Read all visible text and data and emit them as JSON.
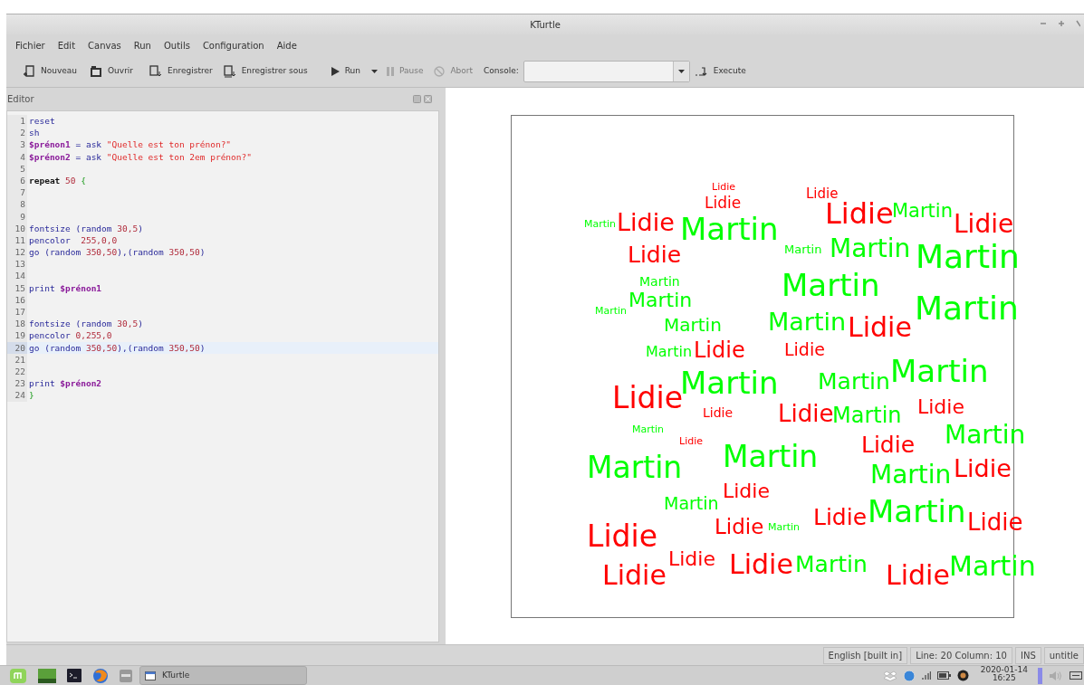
{
  "window": {
    "title": "KTurtle"
  },
  "menu": [
    "Fichier",
    "Edit",
    "Canvas",
    "Run",
    "Outils",
    "Configuration",
    "Aide"
  ],
  "toolbar": [
    {
      "kind": "button",
      "label": "Nouveau",
      "disabled": false
    },
    {
      "kind": "button",
      "label": "Ouvrir",
      "disabled": false
    },
    {
      "kind": "button",
      "label": "Enregistrer",
      "disabled": false
    },
    {
      "kind": "button",
      "label": "Enregistrer sous",
      "disabled": false
    },
    {
      "kind": "split",
      "label": "Run",
      "disabled": false
    },
    {
      "kind": "button",
      "label": "Pause",
      "disabled": true
    },
    {
      "kind": "button",
      "label": "Abort",
      "disabled": true
    },
    {
      "kind": "console",
      "label": "Console:"
    },
    {
      "kind": "button",
      "label": "Execute",
      "disabled": false
    }
  ],
  "editor": {
    "title": "Editor",
    "lines": [
      {
        "number": "1",
        "current": false,
        "tokens": [
          {
            "kind": "command",
            "text": "reset"
          }
        ]
      },
      {
        "number": "2",
        "current": false,
        "tokens": [
          {
            "kind": "command",
            "text": "sh"
          }
        ]
      },
      {
        "number": "3",
        "current": false,
        "tokens": [
          {
            "kind": "variable",
            "text": "$prénon1"
          },
          {
            "kind": "command",
            "text": " = ask "
          },
          {
            "kind": "string",
            "text": "\"Quelle est ton prénon?\""
          }
        ]
      },
      {
        "number": "4",
        "current": false,
        "tokens": [
          {
            "kind": "variable",
            "text": "$prénon2"
          },
          {
            "kind": "command",
            "text": " = ask "
          },
          {
            "kind": "string",
            "text": "\"Quelle est ton 2em prénon?\""
          }
        ]
      },
      {
        "number": "5",
        "current": false
      },
      {
        "number": "6",
        "current": false,
        "tokens": [
          {
            "kind": "keyword",
            "text": "repeat "
          },
          {
            "kind": "number",
            "text": "50 "
          },
          {
            "kind": "bracket",
            "text": "{"
          }
        ]
      },
      {
        "number": "7",
        "current": false
      },
      {
        "number": "8",
        "current": false
      },
      {
        "number": "9",
        "current": false
      },
      {
        "number": "10",
        "current": false,
        "tokens": [
          {
            "kind": "command",
            "text": "fontsize (random "
          },
          {
            "kind": "number",
            "text": "30,5"
          },
          {
            "kind": "command",
            "text": ")"
          }
        ]
      },
      {
        "number": "11",
        "current": false,
        "tokens": [
          {
            "kind": "command",
            "text": "pencolor  "
          },
          {
            "kind": "number",
            "text": "255,0,0"
          }
        ]
      },
      {
        "number": "12",
        "current": false,
        "tokens": [
          {
            "kind": "command",
            "text": "go (random "
          },
          {
            "kind": "number",
            "text": "350,50"
          },
          {
            "kind": "command",
            "text": "),(random "
          },
          {
            "kind": "number",
            "text": "350,50"
          },
          {
            "kind": "command",
            "text": ")"
          }
        ]
      },
      {
        "number": "13",
        "current": false
      },
      {
        "number": "14",
        "current": false
      },
      {
        "number": "15",
        "current": false,
        "tokens": [
          {
            "kind": "command",
            "text": "print "
          },
          {
            "kind": "variable",
            "text": "$prénon1"
          }
        ]
      },
      {
        "number": "16",
        "current": false
      },
      {
        "number": "17",
        "current": false
      },
      {
        "number": "18",
        "current": false,
        "tokens": [
          {
            "kind": "command",
            "text": "fontsize (random "
          },
          {
            "kind": "number",
            "text": "30,5"
          },
          {
            "kind": "command",
            "text": ")"
          }
        ]
      },
      {
        "number": "19",
        "current": false,
        "tokens": [
          {
            "kind": "command",
            "text": "pencolor "
          },
          {
            "kind": "number",
            "text": "0,255,0"
          }
        ]
      },
      {
        "number": "20",
        "current": true,
        "tokens": [
          {
            "kind": "command",
            "text": "go (random "
          },
          {
            "kind": "number",
            "text": "350,50"
          },
          {
            "kind": "command",
            "text": "),(random "
          },
          {
            "kind": "number",
            "text": "350,50"
          },
          {
            "kind": "command",
            "text": ")"
          }
        ]
      },
      {
        "number": "21",
        "current": false
      },
      {
        "number": "22",
        "current": false
      },
      {
        "number": "23",
        "current": false,
        "tokens": [
          {
            "kind": "command",
            "text": "print "
          },
          {
            "kind": "variable",
            "text": "$prénon2"
          }
        ]
      },
      {
        "number": "24",
        "current": false,
        "tokens": [
          {
            "kind": "bracket",
            "text": "}"
          }
        ]
      }
    ]
  },
  "canvas": {
    "words": [
      {
        "text": "Lidie",
        "color": "#ff0000"
      },
      {
        "text": "Lidie",
        "color": "#ff0000"
      },
      {
        "text": "Lidie",
        "color": "#ff0000"
      },
      {
        "text": "Lidie",
        "color": "#ff0000"
      },
      {
        "text": "Martin",
        "color": "#00ff00"
      },
      {
        "text": "Martin",
        "color": "#00ff00"
      },
      {
        "text": "Lidie",
        "color": "#ff0000"
      },
      {
        "text": "Lidie",
        "color": "#ff0000"
      },
      {
        "text": "Martin",
        "color": "#00ff00"
      },
      {
        "text": "Martin",
        "color": "#00ff00"
      },
      {
        "text": "Martin",
        "color": "#00ff00"
      },
      {
        "text": "Lidie",
        "color": "#ff0000"
      },
      {
        "text": "Martin",
        "color": "#00ff00"
      },
      {
        "text": "Martin",
        "color": "#00ff00"
      },
      {
        "text": "Martin",
        "color": "#00ff00"
      },
      {
        "text": "Martin",
        "color": "#00ff00"
      },
      {
        "text": "Martin",
        "color": "#00ff00"
      },
      {
        "text": "Martin",
        "color": "#00ff00"
      },
      {
        "text": "Martin",
        "color": "#00ff00"
      },
      {
        "text": "Lidie",
        "color": "#ff0000"
      },
      {
        "text": "Martin",
        "color": "#00ff00"
      },
      {
        "text": "Martin",
        "color": "#00ff00"
      },
      {
        "text": "Lidie",
        "color": "#ff0000"
      },
      {
        "text": "Lidie",
        "color": "#ff0000"
      },
      {
        "text": "Martin",
        "color": "#00ff00"
      },
      {
        "text": "Lidie",
        "color": "#ff0000"
      },
      {
        "text": "Martin",
        "color": "#00ff00"
      },
      {
        "text": "Lidie",
        "color": "#ff0000"
      },
      {
        "text": "Lidie",
        "color": "#ff0000"
      },
      {
        "text": "Martin",
        "color": "#00ff00"
      },
      {
        "text": "Martin",
        "color": "#00ff00"
      },
      {
        "text": "Lidie",
        "color": "#ff0000"
      },
      {
        "text": "Martin",
        "color": "#00ff00"
      },
      {
        "text": "Lidie",
        "color": "#ff0000"
      },
      {
        "text": "Martin",
        "color": "#00ff00"
      },
      {
        "text": "Lidie",
        "color": "#ff0000"
      },
      {
        "text": "Martin",
        "color": "#00ff00"
      },
      {
        "text": "Martin",
        "color": "#00ff00"
      },
      {
        "text": "Martin",
        "color": "#00ff00"
      },
      {
        "text": "Lidie",
        "color": "#ff0000"
      },
      {
        "text": "Martin",
        "color": "#00ff00"
      },
      {
        "text": "Lidie",
        "color": "#ff0000"
      },
      {
        "text": "Lidie",
        "color": "#ff0000"
      },
      {
        "text": "Lidie",
        "color": "#ff0000"
      },
      {
        "text": "Martin",
        "color": "#00ff00"
      },
      {
        "text": "Lidie",
        "color": "#ff0000"
      },
      {
        "text": "Martin",
        "color": "#00ff00"
      },
      {
        "text": "Lidie",
        "color": "#ff0000"
      },
      {
        "text": "Lidie",
        "color": "#ff0000"
      },
      {
        "text": "Lidie",
        "color": "#ff0000"
      },
      {
        "text": "Lidie",
        "color": "#ff0000"
      },
      {
        "text": "Martin",
        "color": "#00ff00"
      },
      {
        "text": "Lidie",
        "color": "#ff0000"
      },
      {
        "text": "Martin",
        "color": "#00ff00"
      }
    ]
  },
  "status_bar": [
    "English [built in]",
    "Line: 20 Column: 10",
    "INS",
    "untitle"
  ],
  "taskbar": {
    "task": "KTurtle",
    "date": "2020-01-14",
    "time": "16:25"
  }
}
